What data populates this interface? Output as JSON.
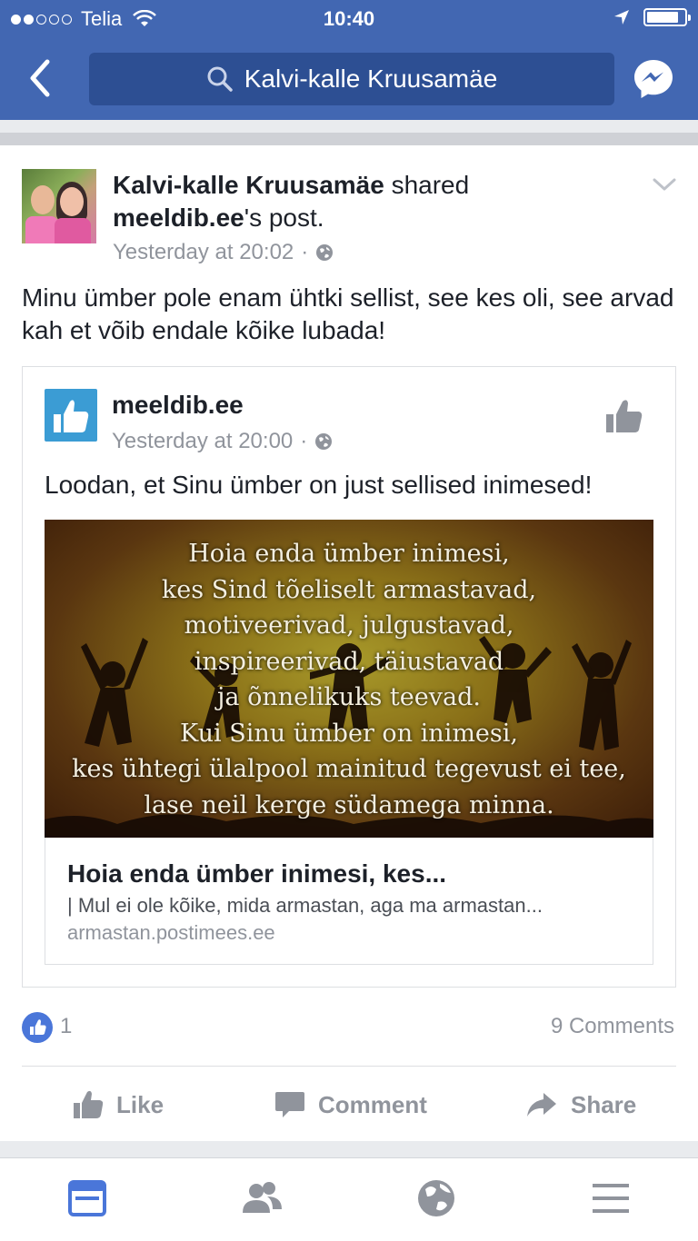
{
  "status_bar": {
    "carrier": "Telia",
    "time": "10:40"
  },
  "header": {
    "search_text": "Kalvi-kalle Kruusamäe"
  },
  "post": {
    "author": "Kalvi-kalle Kruusamäe",
    "shared_word": " shared",
    "shared_source": "meeldib.ee",
    "shared_suffix": "'s post.",
    "timestamp": "Yesterday at 20:02",
    "dot": "·",
    "text": "Minu ümber pole enam ühtki sellist, see kes oli, see arvad kah et võib endale kõike lubada!"
  },
  "shared_post": {
    "page_name": "meeldib.ee",
    "timestamp": "Yesterday at 20:00",
    "dot": "·",
    "text": "Loodan, et Sinu ümber on just sellised inimesed!",
    "image_quote": [
      "Hoia enda ümber inimesi,",
      "kes Sind tõeliselt armastavad,",
      "motiveerivad, julgustavad,",
      "inspireerivad, täiustavad",
      "ja õnnelikuks teevad.",
      "Kui Sinu ümber on inimesi,",
      "kes ühtegi ülalpool mainitud tegevust ei tee,",
      "lase neil kerge südamega minna."
    ],
    "link": {
      "title": "Hoia enda ümber inimesi, kes...",
      "description": "| Mul ei ole kõike, mida armastan, aga ma armastan...",
      "domain": "armastan.postimees.ee"
    }
  },
  "reactions": {
    "count": "1",
    "comments": "9 Comments"
  },
  "actions": {
    "like": "Like",
    "comment": "Comment",
    "share": "Share"
  },
  "colors": {
    "brand": "#4267b2",
    "meta_gray": "#90949c"
  }
}
